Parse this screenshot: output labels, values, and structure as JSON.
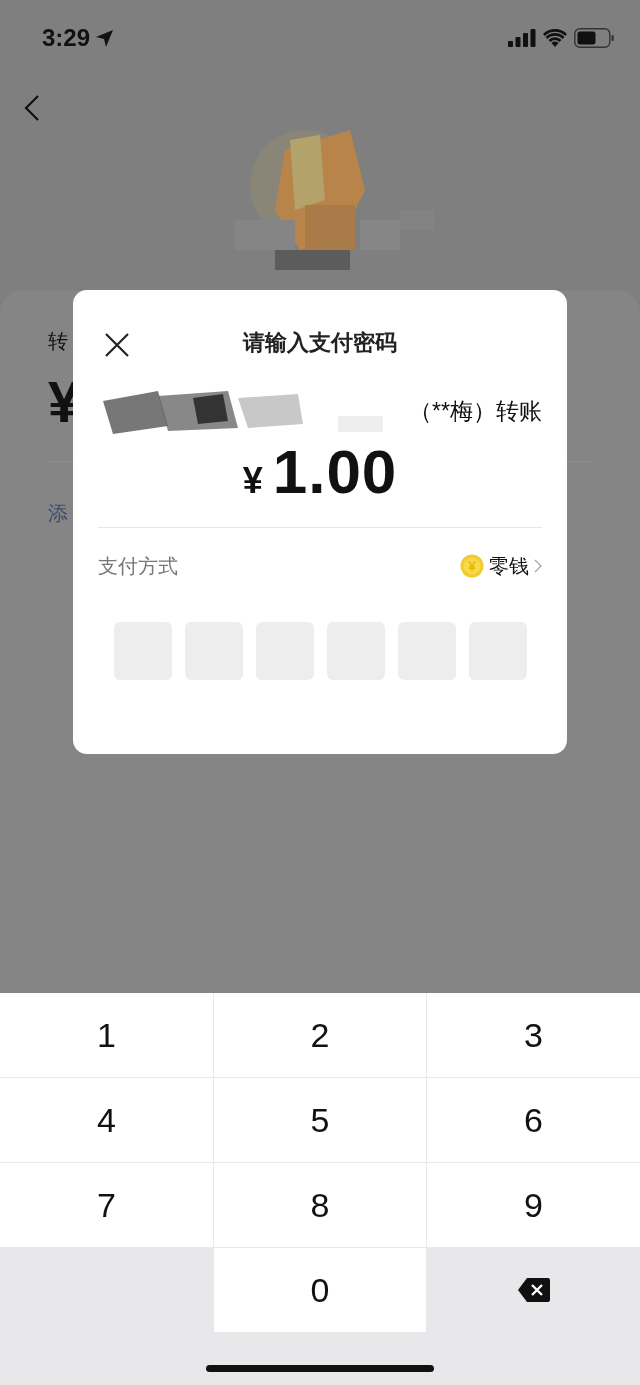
{
  "status_bar": {
    "time": "3:29"
  },
  "background": {
    "labels": [
      {
        "kind": "label",
        "text": "转"
      },
      {
        "kind": "amount",
        "text": "¥"
      },
      {
        "kind": "link",
        "text": "添"
      }
    ]
  },
  "dialog": {
    "title": "请输入支付密码",
    "payee": "（**梅）转账",
    "currency": "¥",
    "amount": "1.00",
    "payment_label": "支付方式",
    "payment_method": "零钱",
    "pin_boxes": [
      {
        "filled": false
      },
      {
        "filled": false
      },
      {
        "filled": false
      },
      {
        "filled": false
      },
      {
        "filled": false
      },
      {
        "filled": false
      }
    ]
  },
  "keypad": [
    {
      "kind": "digit",
      "text": "1"
    },
    {
      "kind": "digit",
      "text": "2"
    },
    {
      "kind": "digit",
      "text": "3"
    },
    {
      "kind": "digit",
      "text": "4"
    },
    {
      "kind": "digit",
      "text": "5"
    },
    {
      "kind": "digit",
      "text": "6"
    },
    {
      "kind": "digit",
      "text": "7"
    },
    {
      "kind": "digit",
      "text": "8"
    },
    {
      "kind": "digit",
      "text": "9"
    },
    {
      "kind": "blank"
    },
    {
      "kind": "digit",
      "text": "0"
    },
    {
      "kind": "backspace"
    }
  ]
}
